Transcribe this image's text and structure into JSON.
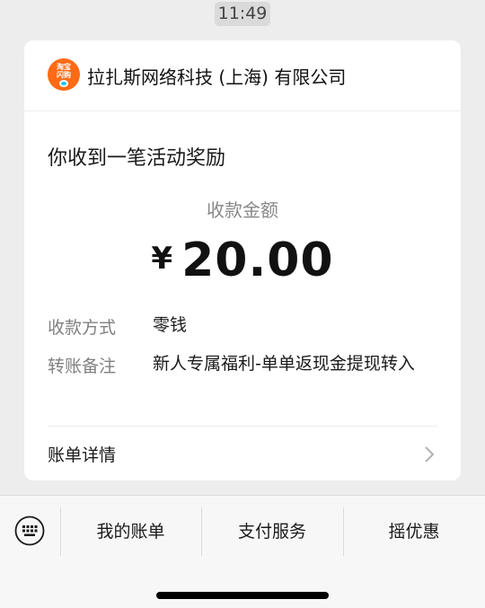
{
  "status": {
    "time": "11:49"
  },
  "header": {
    "logo_text_top": "淘宝",
    "logo_text_bottom": "闪购",
    "company_name": "拉扎斯网络科技 (上海) 有限公司"
  },
  "message": {
    "title": "你收到一笔活动奖励",
    "amount_label": "收款金额",
    "currency_symbol": "¥",
    "amount": "20.00",
    "rows": [
      {
        "label": "收款方式",
        "value": "零钱"
      },
      {
        "label": "转账备注",
        "value": "新人专属福利-单单返现金提现转入"
      }
    ],
    "details_label": "账单详情"
  },
  "bottom_menu": {
    "items": [
      "我的账单",
      "支付服务",
      "摇优惠"
    ]
  },
  "colors": {
    "background": "#ededed",
    "logo": "#ff6a15",
    "secondary_text": "#808080"
  },
  "icons": [
    "keyboard-icon",
    "chevron-right-icon"
  ]
}
